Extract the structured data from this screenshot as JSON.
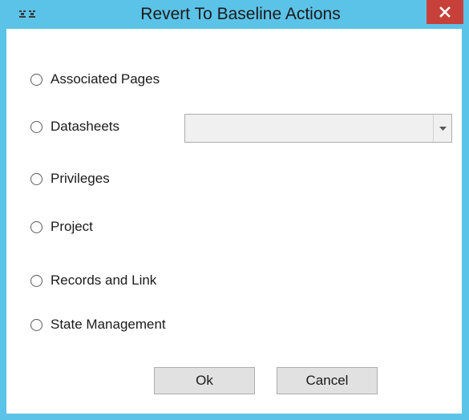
{
  "window": {
    "title": "Revert To Baseline Actions",
    "icon": "app-icon",
    "close_icon": "close-icon"
  },
  "options": [
    {
      "label": "Associated Pages",
      "selected": false
    },
    {
      "label": "Datasheets",
      "selected": false
    },
    {
      "label": "Privileges",
      "selected": false
    },
    {
      "label": "Project",
      "selected": false
    },
    {
      "label": "Records and Link",
      "selected": false
    },
    {
      "label": "State Management",
      "selected": false
    }
  ],
  "datasheet_select": {
    "value": "",
    "icon": "chevron-down-icon"
  },
  "buttons": {
    "ok": "Ok",
    "cancel": "Cancel"
  },
  "colors": {
    "titlebar": "#5cc3e8",
    "close_button": "#c7403a"
  }
}
